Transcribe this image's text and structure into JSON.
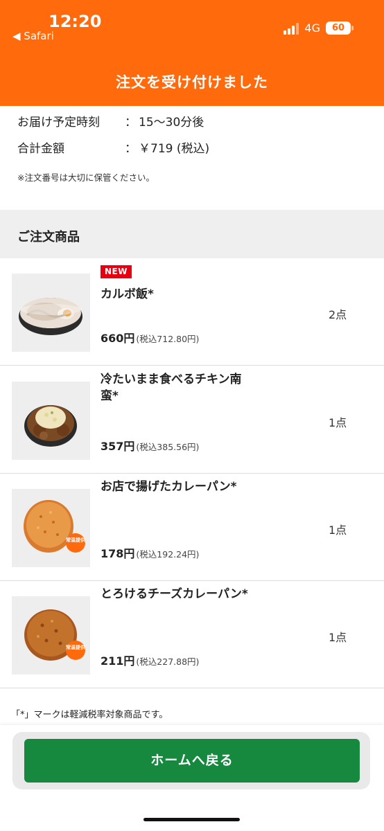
{
  "status_bar": {
    "time": "12:20",
    "back_app": "◀ Safari",
    "network": "4G",
    "battery": "60"
  },
  "header": {
    "title": "注文を受け付けました"
  },
  "summary": {
    "delivery_label": "お届け予定時刻",
    "delivery_value": "15〜30分後",
    "total_label": "合計金額",
    "total_value": "￥719 (税込)",
    "separator": "：",
    "note": "※注文番号は大切に保管ください。"
  },
  "section": {
    "title": "ご注文商品"
  },
  "items": [
    {
      "badge": "NEW",
      "name": "カルボ飯*",
      "price": "660円",
      "tax": "(税込712.80円)",
      "qty": "2点"
    },
    {
      "name": "冷たいまま食べるチキン南蛮*",
      "price": "357円",
      "tax": "(税込385.56円)",
      "qty": "1点"
    },
    {
      "name": "お店で揚げたカレーパン*",
      "price": "178円",
      "tax": "(税込192.24円)",
      "qty": "1点",
      "tag": "常温提供"
    },
    {
      "name": "とろけるチーズカレーパン*",
      "price": "211円",
      "tax": "(税込227.88円)",
      "qty": "1点",
      "tag": "常温提供"
    }
  ],
  "footnote": "「*」マークは軽減税率対象商品です。",
  "button": {
    "home_label": "ホームへ戻る"
  },
  "colors": {
    "header": "#ff6a0c",
    "button": "#16893f",
    "badge": "#e60012"
  }
}
